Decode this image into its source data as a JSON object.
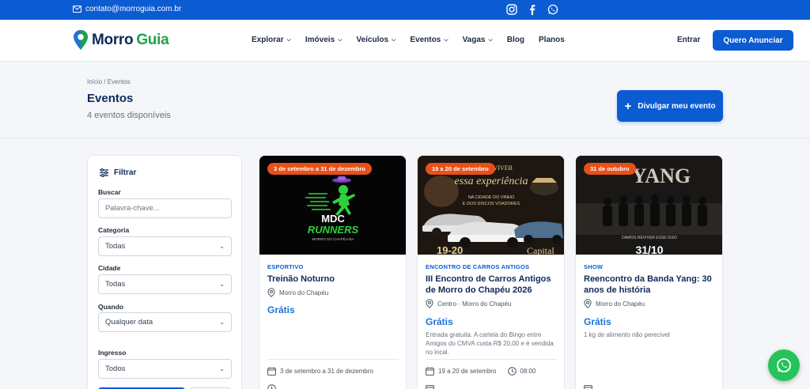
{
  "topbar": {
    "email": "contato@morroguia.com.br",
    "social": [
      "instagram-icon",
      "facebook-icon",
      "whatsapp-icon"
    ]
  },
  "header": {
    "logo_word1": "Morro",
    "logo_word2": "Guia",
    "nav": [
      {
        "label": "Explorar",
        "dropdown": true
      },
      {
        "label": "Imóveis",
        "dropdown": true
      },
      {
        "label": "Veículos",
        "dropdown": true
      },
      {
        "label": "Eventos",
        "dropdown": true
      },
      {
        "label": "Vagas",
        "dropdown": true
      },
      {
        "label": "Blog",
        "dropdown": false
      },
      {
        "label": "Planos",
        "dropdown": false
      }
    ],
    "login": "Entrar",
    "cta": "Quero Anunciar"
  },
  "hero": {
    "breadcrumb": "Início / Eventos",
    "title": "Eventos",
    "subtitle": "4 eventos disponíveis",
    "cta": "Divulgar meu evento"
  },
  "filters": {
    "title": "Filtrar",
    "search_label": "Buscar",
    "search_placeholder": "Palavra-chave...",
    "category_label": "Categoria",
    "category_value": "Todas",
    "city_label": "Cidade",
    "city_value": "Todas",
    "when_label": "Quando",
    "when_value": "Qualquer data",
    "ticket_label": "Ingresso",
    "ticket_value": "Todos"
  },
  "events": [
    {
      "badge": "3 de setembro a 31 de dezembro",
      "image_text": [
        "MDC",
        "RUNNERS",
        "MORRO DO CHAPÉU-BA"
      ],
      "category": "ESPORTIVO",
      "title": "Treinão Noturno",
      "location": "Morro do Chapéu",
      "price": "Grátis",
      "description": "",
      "date": "3 de setembro a 31 de dezembro",
      "time": ""
    },
    {
      "badge": "19 a 20 de setembro",
      "image_text": [
        "VENHA VIVER",
        "essa experiência",
        "NA CIDADE DO VINHO",
        "E DOS DISCOS VOADORES",
        "19-20",
        "Capital"
      ],
      "category": "ENCONTRO DE CARROS ANTIGOS",
      "title": "III Encontro de Carros Antigos de Morro do Chapéu 2026",
      "location": "Centro · Morro do Chapéu",
      "price": "Grátis",
      "description": "Entrada gratuita. A cartela do Bingo entre Amigos do CMVA custa R$ 20,00 e é vendida no local.",
      "date": "19 a 20 de setembro",
      "time": "08:00"
    },
    {
      "badge": "31 de outubro",
      "image_text": [
        "YANG",
        "DAMOS REVIVER ESSE ISSO",
        "31/10"
      ],
      "category": "SHOW",
      "title": "Reencontro da Banda Yang: 30 anos de história",
      "location": "Morro do Chapéu",
      "price": "Grátis",
      "description": "1 kg de alimento não perecível",
      "date": "",
      "time": ""
    }
  ],
  "colors": {
    "primary": "#0b5bd3",
    "badge": "#e8501a",
    "green": "#1fa24a",
    "whatsapp": "#25c35a"
  }
}
